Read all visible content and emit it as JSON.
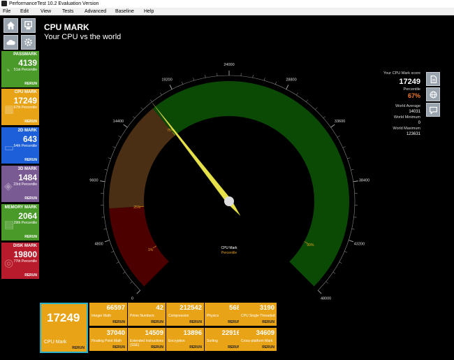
{
  "window": {
    "title": "PerformanceTest 10.2 Evaluation Version"
  },
  "menu": [
    "File",
    "Edit",
    "View",
    "Tests",
    "Advanced",
    "Baseline",
    "Help"
  ],
  "toolbar_icons": [
    "home-icon",
    "system-info-icon",
    "cloud-icon",
    "settings-icon"
  ],
  "sidebar": [
    {
      "label": "PASSMARK",
      "value": "4139",
      "percentile": "51st Percentile",
      "rerun": "RERUN",
      "color": "#4a9a2a",
      "icon": "gauge-icon"
    },
    {
      "label": "CPU MARK",
      "value": "17249",
      "percentile": "67th Percentile",
      "rerun": "RERUN",
      "color": "#e8a317",
      "icon": "cpu-icon"
    },
    {
      "label": "2D MARK",
      "value": "643",
      "percentile": "54th Percentile",
      "rerun": "RERUN",
      "color": "#1c5fd8",
      "icon": "monitor-icon"
    },
    {
      "label": "3D MARK",
      "value": "1484",
      "percentile": "23rd Percentile",
      "rerun": "RERUN",
      "color": "#7a5a92",
      "icon": "cube-icon"
    },
    {
      "label": "MEMORY MARK",
      "value": "2064",
      "percentile": "29th Percentile",
      "rerun": "RERUN",
      "color": "#4a9a2a",
      "icon": "memory-icon"
    },
    {
      "label": "DISK MARK",
      "value": "19800",
      "percentile": "77th Percentile",
      "rerun": "RERUN",
      "color": "#b81c2c",
      "icon": "disk-icon"
    }
  ],
  "main": {
    "title": "CPU MARK",
    "subtitle": "Your CPU vs the world"
  },
  "gauge": {
    "min": 0,
    "max": 48000,
    "value": 17249,
    "ticks": [
      "0",
      "4800",
      "9600",
      "14400",
      "19200",
      "24000",
      "28800",
      "33600",
      "38400",
      "43200",
      "48000"
    ],
    "markers": [
      {
        "label": "1%",
        "value": 2400
      },
      {
        "label": "25%",
        "value": 7400
      },
      {
        "label": "75%",
        "value": 17000
      },
      {
        "label": "99%",
        "value": 45000
      }
    ],
    "center_label": "CPU Mark",
    "center_sub": "Percentile",
    "colors": {
      "red": "#4d0000",
      "brown": "#4a2f14",
      "green": "#0a4a05",
      "needle": "#e6e04a",
      "marker_text": "#e8a317"
    }
  },
  "score_panel": {
    "score_label": "Your CPU Mark score",
    "score": "17249",
    "percentile_label": "Percentile",
    "percentile": "67%",
    "world_avg_label": "World Average",
    "world_avg": "14031",
    "world_min_label": "World Minimum",
    "world_min": "0",
    "world_max_label": "World Maximum",
    "world_max": "123631",
    "icons": [
      "document-icon",
      "globe-icon",
      "chat-icon"
    ]
  },
  "bottom": {
    "main": {
      "value": "17249",
      "name": "CPU Mark",
      "rerun": "RERUN"
    },
    "tiles": [
      {
        "value": "66597",
        "name": "Integer Math",
        "rerun": "RERUN"
      },
      {
        "value": "42",
        "name": "Prime Numbers",
        "rerun": "RERUN"
      },
      {
        "value": "212542",
        "name": "Compression",
        "rerun": "RERUN"
      },
      {
        "value": "568",
        "name": "Physics",
        "rerun": "RERUN"
      },
      {
        "value": "3190",
        "name": "CPU Single Threaded",
        "rerun": "RERUN"
      },
      {
        "value": "37040",
        "name": "Floating Point Math",
        "rerun": "RERUN"
      },
      {
        "value": "14509",
        "name": "Extended Instructions (SSE)",
        "rerun": "RERUN"
      },
      {
        "value": "13896",
        "name": "Encryption",
        "rerun": "RERUN"
      },
      {
        "value": "22916",
        "name": "Sorting",
        "rerun": "RERUN"
      },
      {
        "value": "34609",
        "name": "Cross-platform Mark",
        "rerun": "RERUN"
      }
    ]
  }
}
